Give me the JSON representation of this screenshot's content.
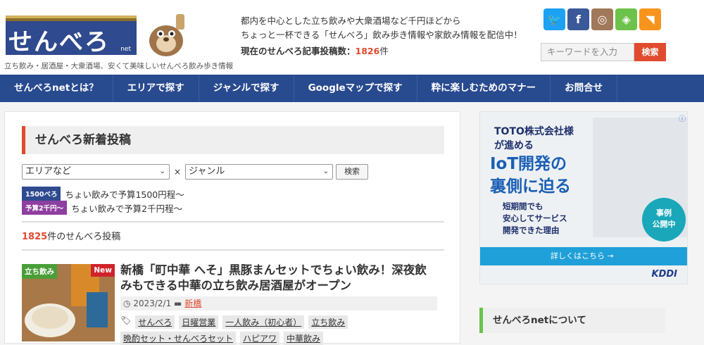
{
  "header": {
    "logo_text": "せんべろ",
    "logo_suffix": "net",
    "tagline": "立ち飲み・居酒屋・大衆酒場、安くて美味しいせんべろ飲み歩き情報",
    "intro_line1": "都内を中心とした立ち飲みや大衆酒場など千円ほどから",
    "intro_line2": "ちょっと一杯できる「せんべろ」飲み歩き情報や家飲み情報を配信中！",
    "count_label": "現在のせんべろ記事投稿数：",
    "count_value": "1826",
    "count_unit": "件",
    "social": [
      {
        "icon": "twitter-icon",
        "glyph": "🐦",
        "color": "#1da1f2"
      },
      {
        "icon": "facebook-icon",
        "glyph": "f",
        "color": "#3b5998"
      },
      {
        "icon": "instagram-icon",
        "glyph": "◎",
        "color": "#a0785a"
      },
      {
        "icon": "feedly-icon",
        "glyph": "◈",
        "color": "#6cc24a"
      },
      {
        "icon": "rss-icon",
        "glyph": "◥",
        "color": "#f7941d"
      }
    ],
    "search_placeholder": "キーワードを入力",
    "search_button": "検索"
  },
  "nav": {
    "items": [
      "せんべろnetとは？",
      "エリアで探す",
      "ジャンルで探す",
      "Googleマップで探す",
      "粋に楽しむためのマナー",
      "お問合せ"
    ]
  },
  "main": {
    "title": "せんべろ新着投稿",
    "area_select": "エリアなど",
    "times": "×",
    "genre_select": "ジャンル",
    "find_button": "検索",
    "legend": [
      {
        "tag": "1500べろ",
        "color": "#2f4a8e",
        "text": "ちょい飲みで予算1500円程～"
      },
      {
        "tag": "予算2千円～",
        "color": "#8e3fa0",
        "text": "ちょい飲みで予算2千円程～"
      }
    ],
    "post_count": "1825",
    "post_count_suffix": "件のせんべろ投稿",
    "post": {
      "category_badge": "立ち飲み",
      "new_badge": "New",
      "title": "新橋「町中華 へそ」黒豚まんセットでちょい飲み！深夜飲みもできる中華の立ち飲み居酒屋がオープン",
      "date": "2023/2/1",
      "category": "新橋",
      "tags": [
        "せんべろ",
        "日曜営業",
        "一人飲み（初心者）",
        "立ち飲み",
        "晩酌セット・せんべろセット",
        "ハピアワ",
        "中華飲み"
      ]
    }
  },
  "sidebar": {
    "ad": {
      "corp_line1": "TOTO株式会社様",
      "corp_line2": "が進める",
      "headline_line1": "IoT開発の",
      "headline_line2": "裏側に迫る",
      "sub_line1": "短期間でも",
      "sub_line2": "安心してサービス",
      "sub_line3": "開発できた理由",
      "circle_line1": "事例",
      "circle_line2": "公開中",
      "strip_text": "詳しくはこちら →",
      "brand": "KDDI",
      "info": "ⓘ"
    },
    "about_title": "せんべろnetについて"
  }
}
